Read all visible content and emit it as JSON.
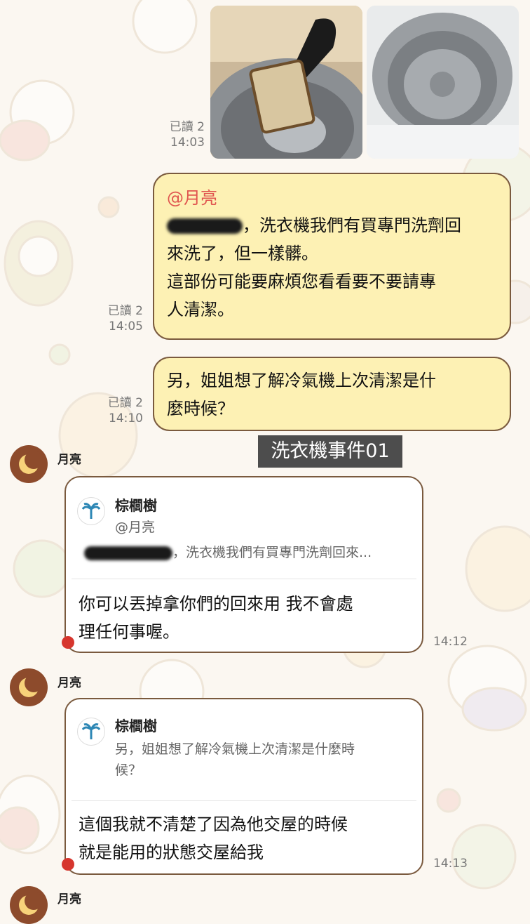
{
  "messages": [
    {
      "id": "photos",
      "read": "已讀 2",
      "time": "14:03"
    },
    {
      "id": "m1",
      "read": "已讀 2",
      "time": "14:05",
      "mention": "@月亮",
      "line1": "，洗衣機我們有買專門洗劑回",
      "line2": "來洗了，但一樣髒。",
      "line3": "這部份可能要麻煩您看看要不要請專",
      "line4": "人清潔。"
    },
    {
      "id": "m2",
      "read": "已讀 2",
      "time": "14:10",
      "line1": "另，姐姐想了解冷氣機上次清潔是什",
      "line2": "麼時候？"
    },
    {
      "id": "r1",
      "sender": "月亮",
      "time": "14:12",
      "quote_name": "棕櫚樹",
      "quote_mention": "@月亮",
      "quote_text": "，洗衣機我們有買專門洗劑回來...",
      "line1": "你可以丟掉拿你們的回來用 我不會處",
      "line2": "理任何事喔。"
    },
    {
      "id": "r2",
      "sender": "月亮",
      "time": "14:13",
      "quote_name": "棕櫚樹",
      "quote_line1": "另，姐姐想了解冷氣機上次清潔是什麼時",
      "quote_line2": "候？",
      "line1": "這個我就不清楚了因為他交屋的時候",
      "line2": "就是能用的狀態交屋給我"
    }
  ],
  "next_sender": "月亮",
  "caption": "洗衣機事件01",
  "icons": {
    "avatar": "moon-icon",
    "quote_avatar": "palm-tree-icon"
  },
  "colors": {
    "outgoing_bubble": "#fdf1b4",
    "bubble_border": "#7a5a3e",
    "mention": "#e0554f",
    "avatar_bg": "#8d4b2c"
  }
}
